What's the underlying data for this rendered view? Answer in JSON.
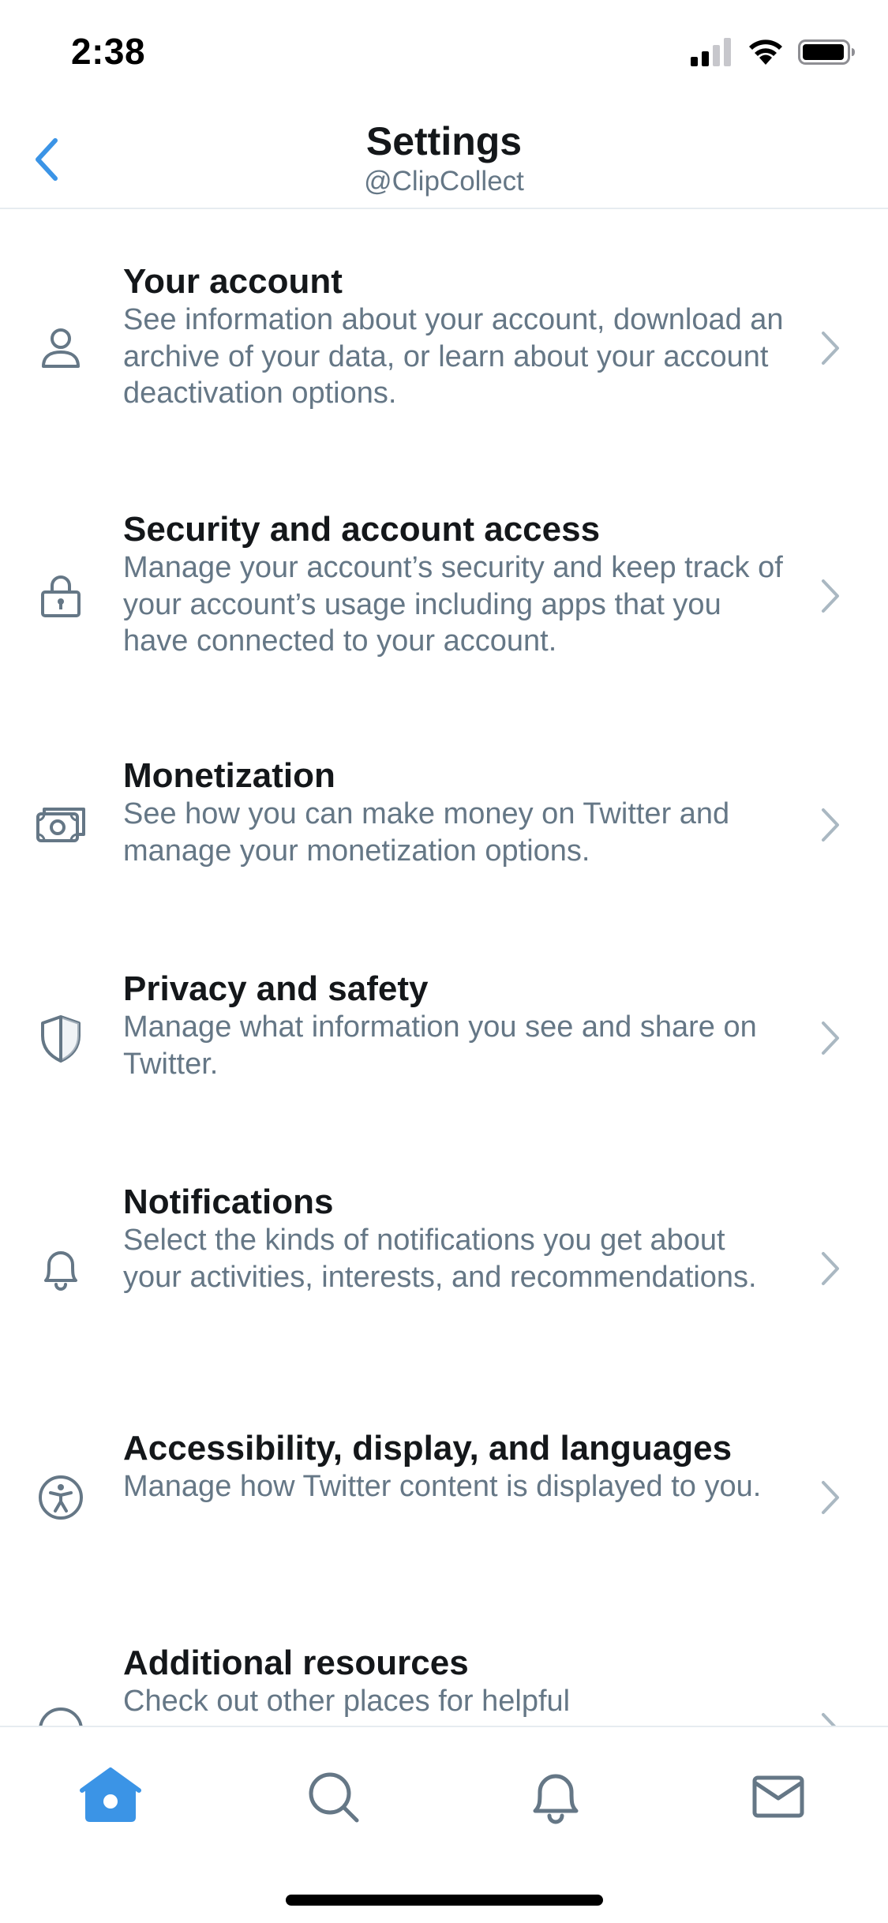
{
  "status_bar": {
    "time": "2:38",
    "icons": [
      "cellular-signal-icon",
      "wifi-icon",
      "battery-icon"
    ]
  },
  "header": {
    "title": "Settings",
    "subtitle": "@ClipCollect",
    "back_icon": "chevron-left-icon"
  },
  "colors": {
    "accent": "#1DA1F2",
    "back_icon": "#3b94e6",
    "text_primary": "#14171a",
    "text_secondary": "#657786",
    "divider": "#e6ecf0",
    "chevron": "#aab8c2"
  },
  "settings": [
    {
      "icon": "person-icon",
      "title": "Your account",
      "description": "See information about your account, download an archive of your data, or learn about your account deactivation options."
    },
    {
      "icon": "lock-icon",
      "title": "Security and account access",
      "description": "Manage your account’s security and keep track of your account’s usage including apps that you have connected to your account."
    },
    {
      "icon": "money-icon",
      "title": "Monetization",
      "description": "See how you can make money on Twitter and manage your monetization options."
    },
    {
      "icon": "shield-icon",
      "title": "Privacy and safety",
      "description": "Manage what information you see and share on Twitter."
    },
    {
      "icon": "bell-icon",
      "title": "Notifications",
      "description": "Select the kinds of notifications you get about your activities, interests, and recommendations."
    },
    {
      "icon": "accessibility-icon",
      "title": "Accessibility, display, and languages",
      "description": "Manage how Twitter content is displayed to you."
    },
    {
      "icon": "more-icon",
      "title": "Additional resources",
      "description": "Check out other places for helpful"
    }
  ],
  "tab_bar": {
    "tabs": [
      {
        "icon": "home-icon",
        "active": true
      },
      {
        "icon": "search-icon",
        "active": false
      },
      {
        "icon": "bell-icon",
        "active": false
      },
      {
        "icon": "mail-icon",
        "active": false
      }
    ]
  }
}
